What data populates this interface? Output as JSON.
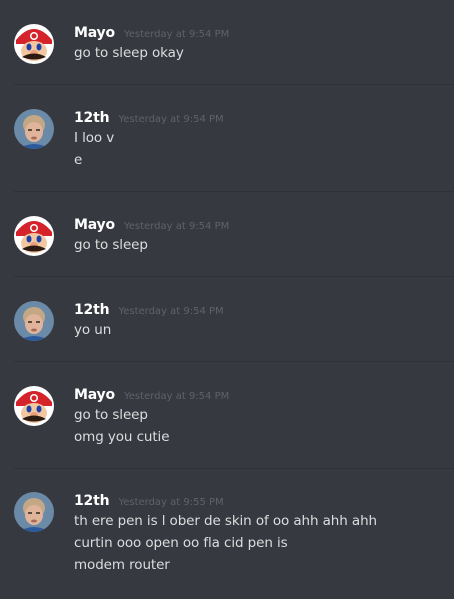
{
  "messages": [
    {
      "username": "Mayo",
      "timestamp": "Yesterday at 9:54 PM",
      "avatar_icon": "mario-avatar-icon",
      "lines": [
        "go to sleep okay"
      ]
    },
    {
      "username": "12th",
      "timestamp": "Yesterday at 9:54 PM",
      "avatar_icon": "person-avatar-icon",
      "lines": [
        "I loo v",
        "e"
      ]
    },
    {
      "username": "Mayo",
      "timestamp": "Yesterday at 9:54 PM",
      "avatar_icon": "mario-avatar-icon",
      "lines": [
        "go to sleep"
      ]
    },
    {
      "username": "12th",
      "timestamp": "Yesterday at 9:54 PM",
      "avatar_icon": "person-avatar-icon",
      "lines": [
        "yo un"
      ]
    },
    {
      "username": "Mayo",
      "timestamp": "Yesterday at 9:54 PM",
      "avatar_icon": "mario-avatar-icon",
      "lines": [
        "go to sleep",
        "omg you cutie"
      ]
    },
    {
      "username": "12th",
      "timestamp": "Yesterday at 9:55 PM",
      "avatar_icon": "person-avatar-icon",
      "lines": [
        "th ere pen is l ober de skin of oo ahh ahh ahh",
        "curtin ooo open oo fla cid pen is",
        "modem router"
      ]
    }
  ],
  "colors": {
    "background": "#36393f",
    "username": "#ffffff",
    "timestamp": "#5f6369",
    "message_text": "#dcddde",
    "divider": "#2f3136"
  }
}
